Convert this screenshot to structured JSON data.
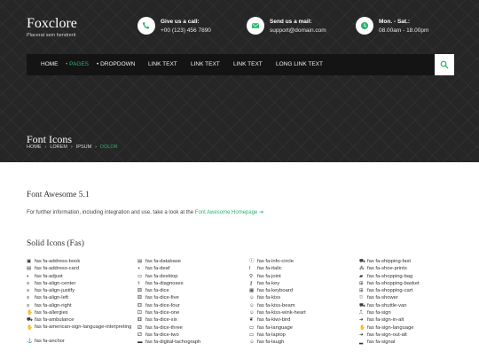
{
  "brand": {
    "name": "Foxclore",
    "tagline": "Placerat sem hendrerit"
  },
  "contacts": [
    {
      "icon": "phone-icon",
      "title": "Give us a call:",
      "value": "+00 (123) 456 7890"
    },
    {
      "icon": "envelope-icon",
      "title": "Send us a mail:",
      "value": "support@domain.com"
    },
    {
      "icon": "clock-icon",
      "title": "Mon. - Sat.:",
      "value": "08.00am - 18.00pm"
    }
  ],
  "nav": {
    "home": "HOME",
    "pages": "PAGES",
    "dropdown": "DROPDOWN",
    "link1": "LINK TEXT",
    "link2": "LINK TEXT",
    "link3": "LINK TEXT",
    "link4": "LONG LINK TEXT"
  },
  "page_title": "Font Icons",
  "breadcrumb": [
    "HOME",
    "LOREM",
    "IPSUM",
    "DOLOR"
  ],
  "section": {
    "title": "Font Awesome 5.1",
    "text": "For further information, including integration and use, take a look at the",
    "link": "Font Awesome Homepage"
  },
  "solid_title": "Solid Icons (Fas)",
  "columns": [
    [
      {
        "g": "▣",
        "label": "fas fa-address-book"
      },
      {
        "g": "▤",
        "label": "fas fa-address-card"
      },
      {
        "g": "◐",
        "label": "fas fa-adjust"
      },
      {
        "g": "≡",
        "label": "fas fa-align-center"
      },
      {
        "g": "≡",
        "label": "fas fa-align-justify"
      },
      {
        "g": "≡",
        "label": "fas fa-align-left"
      },
      {
        "g": "≡",
        "label": "fas fa-align-right"
      },
      {
        "g": "✋",
        "label": "fas fa-allergies"
      },
      {
        "g": "⛟",
        "label": "fas fa-ambulance"
      },
      {
        "g": "✋",
        "label": "fas fa-american-sign-language-interpreting",
        "wrap": true
      },
      {
        "g": "⚓",
        "label": "fas fa-anchor"
      }
    ],
    [
      {
        "g": "▤",
        "label": "fas fa-database"
      },
      {
        "g": "◖",
        "label": "fas fa-deaf"
      },
      {
        "g": "▭",
        "label": "fas fa-desktop"
      },
      {
        "g": "⚕",
        "label": "fas fa-diagnoses"
      },
      {
        "g": "⚄",
        "label": "fas fa-dice"
      },
      {
        "g": "⚄",
        "label": "fas fa-dice-five"
      },
      {
        "g": "⚃",
        "label": "fas fa-dice-four"
      },
      {
        "g": "⚀",
        "label": "fas fa-dice-one"
      },
      {
        "g": "⚅",
        "label": "fas fa-dice-six"
      },
      {
        "g": "⚂",
        "label": "fas fa-dice-three"
      },
      {
        "g": "⚁",
        "label": "fas fa-dice-two"
      },
      {
        "g": "▬",
        "label": "fas fa-digital-tachograph"
      }
    ],
    [
      {
        "g": "ⓘ",
        "label": "fas fa-info-circle"
      },
      {
        "g": "I",
        "label": "fas fa-italic"
      },
      {
        "g": "⚲",
        "label": "fas fa-joint"
      },
      {
        "g": "⚷",
        "label": "fas fa-key"
      },
      {
        "g": "▦",
        "label": "fas fa-keyboard"
      },
      {
        "g": "☺",
        "label": "fas fa-kiss"
      },
      {
        "g": "☺",
        "label": "fas fa-kiss-beam"
      },
      {
        "g": "☺",
        "label": "fas fa-kiss-wink-heart"
      },
      {
        "g": "❦",
        "label": "fas fa-kiwi-bird"
      },
      {
        "g": "▭",
        "label": "fas fa-language"
      },
      {
        "g": "▭",
        "label": "fas fa-laptop"
      },
      {
        "g": "☺",
        "label": "fas fa-laugh"
      }
    ],
    [
      {
        "g": "⛟",
        "label": "fas fa-shipping-fast"
      },
      {
        "g": "⁂",
        "label": "fas fa-shoe-prints"
      },
      {
        "g": "▰",
        "label": "fas fa-shopping-bag"
      },
      {
        "g": "⊞",
        "label": "fas fa-shopping-basket"
      },
      {
        "g": "⊞",
        "label": "fas fa-shopping-cart"
      },
      {
        "g": "⛆",
        "label": "fas fa-shower"
      },
      {
        "g": "⛟",
        "label": "fas fa-shuttle-van"
      },
      {
        "g": "⎍",
        "label": "fas fa-sign"
      },
      {
        "g": "➜",
        "label": "fas fa-sign-in-alt"
      },
      {
        "g": "✋",
        "label": "fas fa-sign-language"
      },
      {
        "g": "➜",
        "label": "fas fa-sign-out-alt"
      },
      {
        "g": "▂",
        "label": "fas fa-signal"
      }
    ]
  ],
  "accent_color": "#2fb36d"
}
